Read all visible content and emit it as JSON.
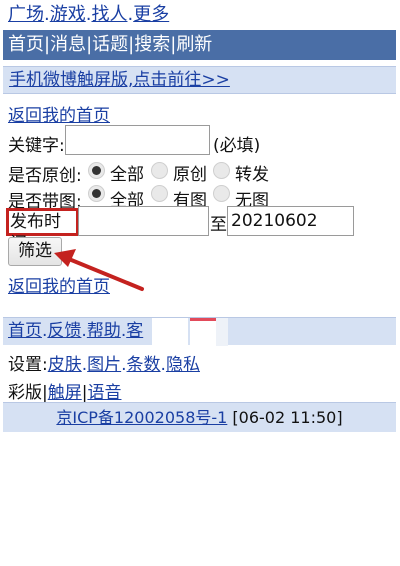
{
  "top_nav": {
    "items": [
      "广场",
      "游戏",
      "找人",
      "更多"
    ],
    "separator": "."
  },
  "title_bar": {
    "items": [
      "首页",
      "消息",
      "话题",
      "搜索",
      "刷新"
    ],
    "separator": "|"
  },
  "promo": {
    "text": "手机微博触屏版,点击前往>>"
  },
  "back_home": "返回我的首页",
  "form": {
    "keyword_label": "关键字:",
    "keyword_value": "",
    "keyword_required": "(必填)",
    "original_label": "是否原创:",
    "original_options": [
      "全部",
      "原创",
      "转发"
    ],
    "original_selected": "全部",
    "picture_label": "是否带图:",
    "picture_options": [
      "全部",
      "有图",
      "无图"
    ],
    "picture_selected": "全部",
    "time_label": "发布时间",
    "time_start": "",
    "time_to": "至",
    "time_end": "20210602",
    "submit_label": "筛选"
  },
  "back_home_bottom": "返回我的首页",
  "footer_nav": {
    "items": [
      "首页",
      "反馈",
      "帮助"
    ],
    "partial": "客"
  },
  "settings": {
    "label": "设置:",
    "items": [
      "皮肤",
      "图片",
      "条数",
      "隐私"
    ]
  },
  "mode": {
    "prefix": "彩版|",
    "items": [
      "触屏",
      "语音"
    ]
  },
  "icp": {
    "link": "京ICP备12002058号-1",
    "timestamp": "[06-02 11:50]"
  },
  "colors": {
    "link": "#1a3fa3",
    "title_bar": "#4a6ea6",
    "light_bar": "#d6e1f3",
    "highlight": "#c4221f"
  }
}
